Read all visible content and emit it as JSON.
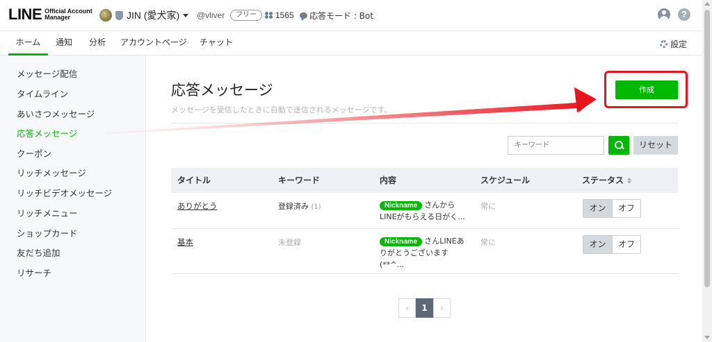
{
  "header": {
    "logo_main": "LINE",
    "logo_sub_1": "Official Account",
    "logo_sub_2": "Manager",
    "account_name": "JIN (愛犬家)",
    "account_id": "@vliver",
    "plan": "フリー",
    "friends_count": "1565",
    "mode": "応答モード : Bot",
    "help_label": "?"
  },
  "nav": {
    "tabs": [
      "ホーム",
      "通知",
      "分析",
      "アカウントページ",
      "チャット"
    ],
    "active_tab": "ホーム",
    "settings_label": "設定"
  },
  "sidebar": {
    "items": [
      "メッセージ配信",
      "タイムライン",
      "あいさつメッセージ",
      "応答メッセージ",
      "クーポン",
      "リッチメッセージ",
      "リッチビデオメッセージ",
      "リッチメニュー",
      "ショップカード",
      "友だち追加",
      "リサーチ"
    ],
    "active_item": "応答メッセージ"
  },
  "main": {
    "title": "応答メッセージ",
    "description": "メッセージを受信したときに自動で送信されるメッセージです。",
    "create_label": "作成",
    "keyword_placeholder": "キーワード",
    "reset_label": "リセット",
    "columns": [
      "タイトル",
      "キーワード",
      "内容",
      "スケジュール",
      "ステータス"
    ],
    "rows": [
      {
        "title": "ありがとう",
        "keyword": "登録済み",
        "keyword_count": "(1)",
        "nickname": "Nickname",
        "content": "さんからLINEがもらえる日がく...",
        "schedule": "常に",
        "on": "オン",
        "off": "オフ"
      },
      {
        "title": "基本",
        "keyword": "未登録",
        "keyword_count": "",
        "nickname": "Nickname",
        "content": "さんLINEありがとうございます(**^...",
        "schedule": "常に",
        "on": "オン",
        "off": "オフ"
      }
    ],
    "pagination": {
      "prev": "‹",
      "current": "1",
      "next": "›"
    }
  },
  "colors": {
    "accent": "#00b900",
    "annotation": "#e8141c",
    "header_row": "#eef0f3",
    "toggle_active": "#d4d9de"
  }
}
